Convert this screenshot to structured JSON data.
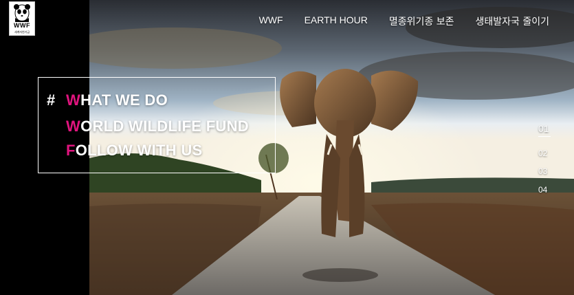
{
  "brand": {
    "logo_text": "WWF",
    "logo_subtext": "세계자연기금"
  },
  "nav": {
    "items": [
      {
        "label": "WWF"
      },
      {
        "label": "EARTH HOUR"
      },
      {
        "label": "멸종위기종 보존"
      },
      {
        "label": "생태발자국 줄이기"
      }
    ]
  },
  "hero": {
    "hash": "#",
    "menu": [
      {
        "first": "W",
        "rest": "HAT WE DO"
      },
      {
        "first": "W",
        "rest": "ORLD WILDLIFE FUND"
      },
      {
        "first": "F",
        "rest": "OLLOW WITH US"
      }
    ],
    "accent_color": "#e0147e"
  },
  "pager": {
    "items": [
      "01",
      "02",
      "03",
      "04"
    ],
    "active": "01"
  }
}
